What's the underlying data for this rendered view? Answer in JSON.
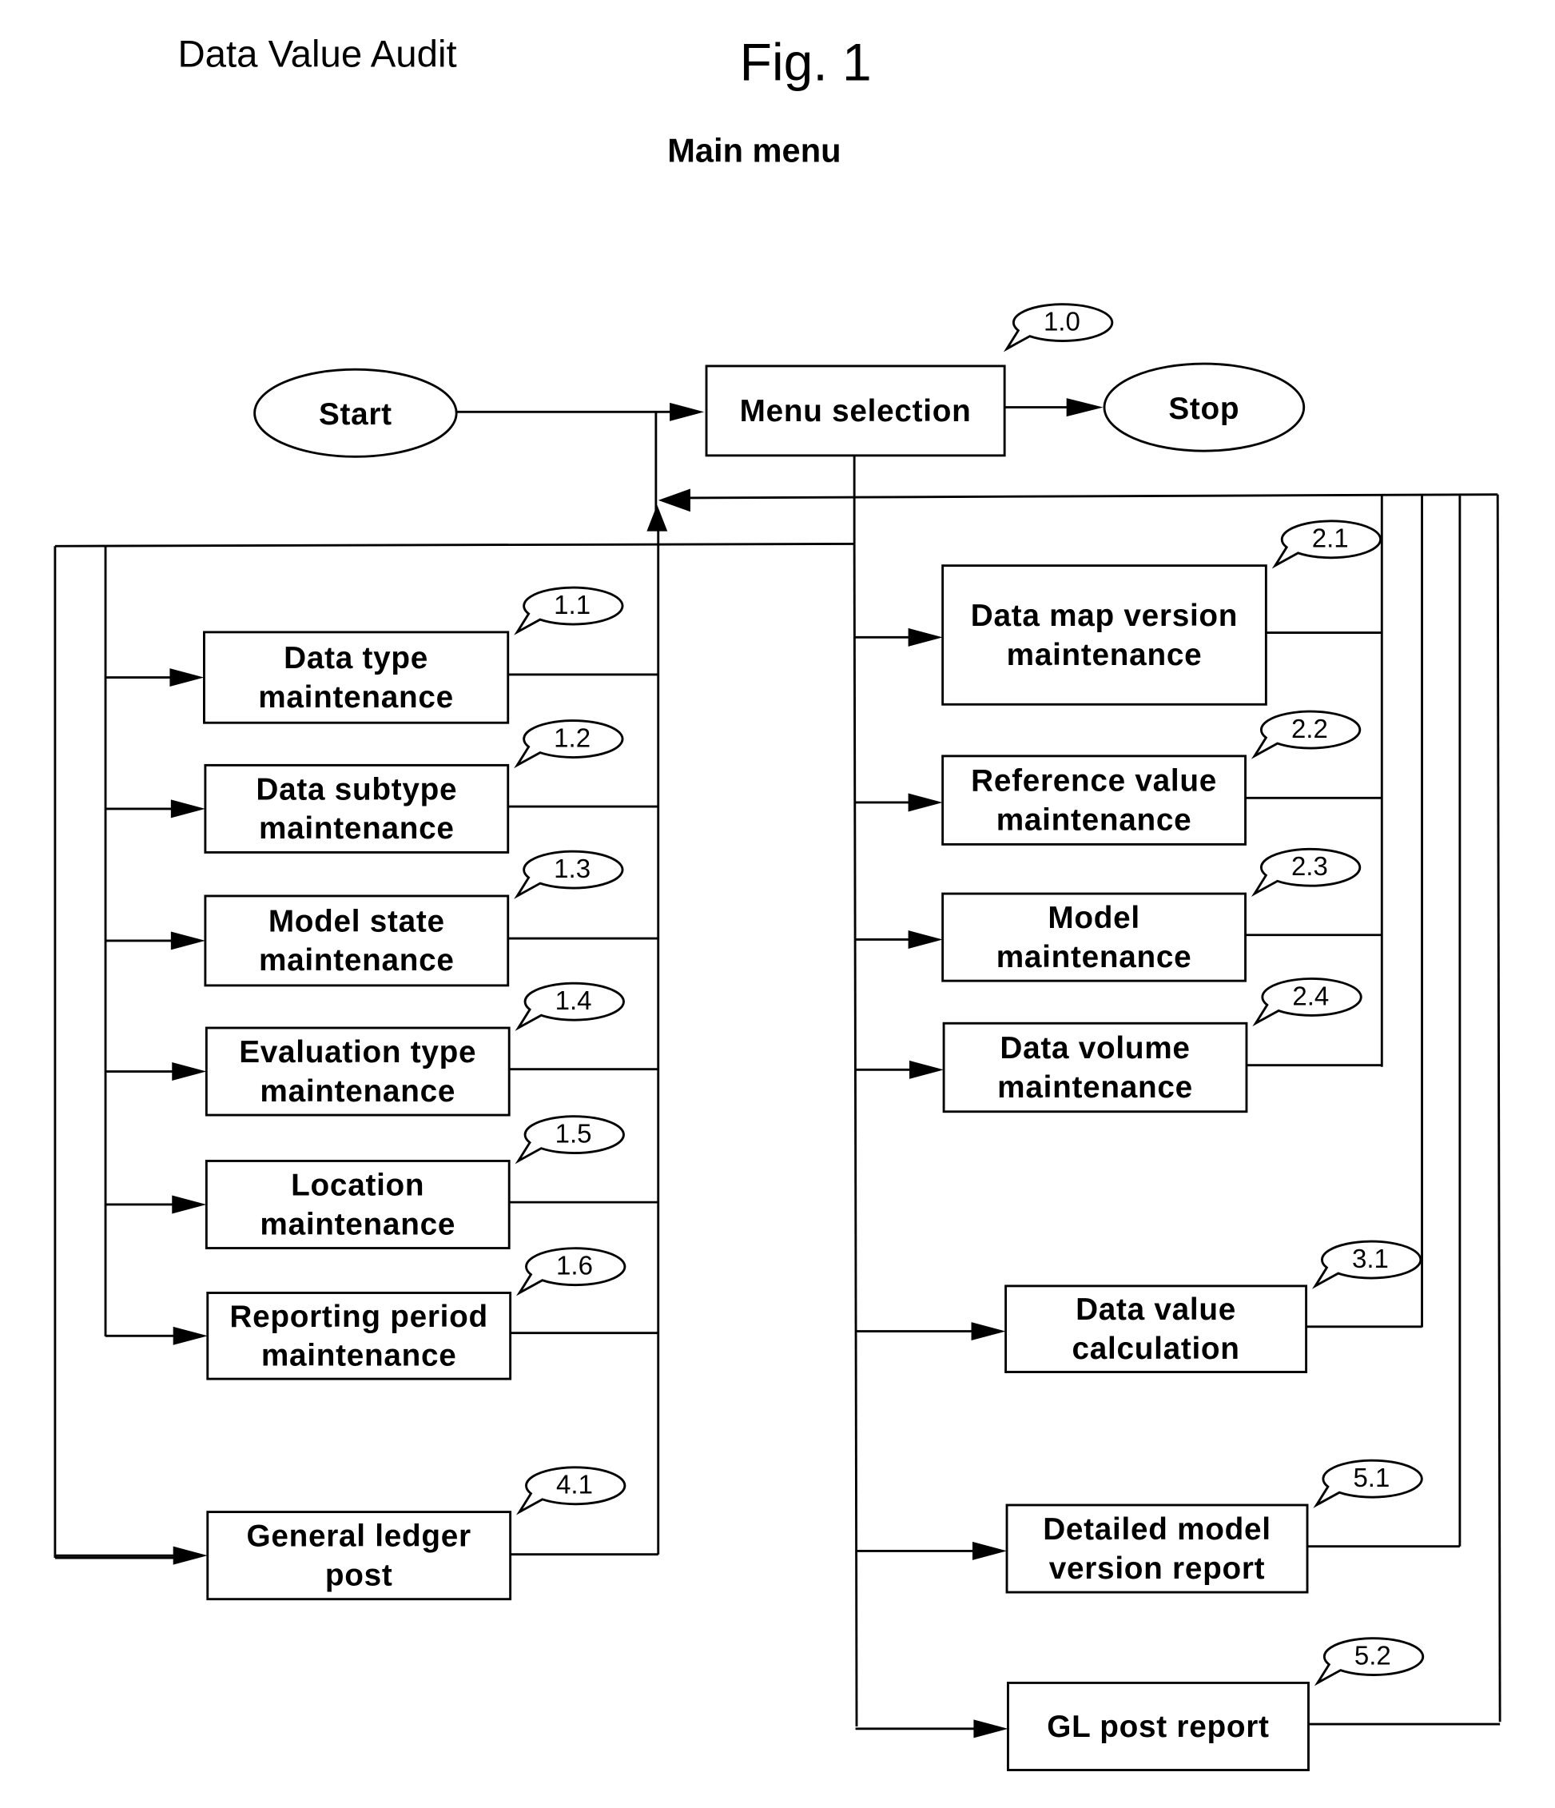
{
  "header": {
    "title": "Data Value Audit",
    "figure": "Fig. 1",
    "subtitle": "Main menu"
  },
  "terminals": {
    "start": "Start",
    "stop": "Stop"
  },
  "menu": {
    "label": "Menu selection",
    "ref": "1.0"
  },
  "left_boxes": [
    {
      "ref": "1.1",
      "lines": [
        "Data type",
        "maintenance"
      ]
    },
    {
      "ref": "1.2",
      "lines": [
        "Data subtype",
        "maintenance"
      ]
    },
    {
      "ref": "1.3",
      "lines": [
        "Model state",
        "maintenance"
      ]
    },
    {
      "ref": "1.4",
      "lines": [
        "Evaluation type",
        "maintenance"
      ]
    },
    {
      "ref": "1.5",
      "lines": [
        "Location",
        "maintenance"
      ]
    },
    {
      "ref": "1.6",
      "lines": [
        "Reporting period",
        "maintenance"
      ]
    },
    {
      "ref": "4.1",
      "lines": [
        "General ledger",
        "post"
      ]
    }
  ],
  "right_boxes": [
    {
      "ref": "2.1",
      "lines": [
        "Data map version",
        "maintenance"
      ]
    },
    {
      "ref": "2.2",
      "lines": [
        "Reference value",
        "maintenance"
      ]
    },
    {
      "ref": "2.3",
      "lines": [
        "Model",
        "maintenance"
      ]
    },
    {
      "ref": "2.4",
      "lines": [
        "Data volume",
        "maintenance"
      ]
    },
    {
      "ref": "3.1",
      "lines": [
        "Data value",
        "calculation"
      ]
    },
    {
      "ref": "5.1",
      "lines": [
        "Detailed model",
        "version report"
      ]
    },
    {
      "ref": "5.2",
      "lines": [
        "GL post  report"
      ]
    }
  ]
}
